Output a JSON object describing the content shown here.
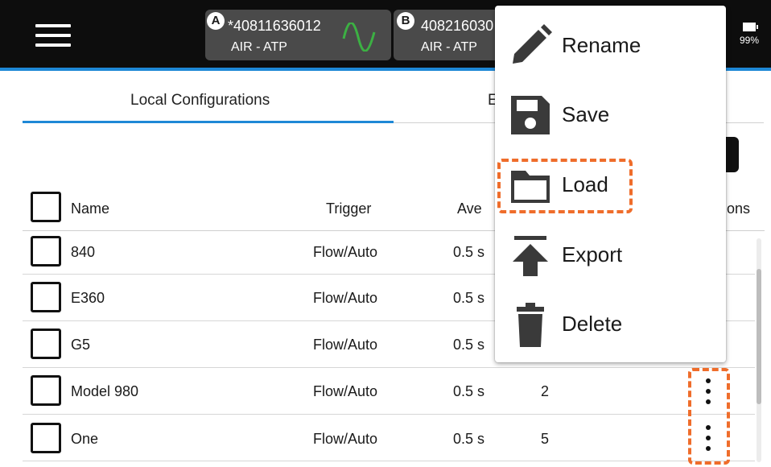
{
  "topbar": {
    "device_a": {
      "badge": "A",
      "serial": "*40811636012",
      "gas": "AIR - ATP",
      "wave_color": "#3cb043"
    },
    "device_b": {
      "badge": "B",
      "serial": "408216030",
      "gas": "AIR - ATP"
    },
    "battery": "99%"
  },
  "tabs": [
    {
      "label": "Local Configurations",
      "active": true
    },
    {
      "label": "E",
      "active": false
    }
  ],
  "table": {
    "headers": {
      "name": "Name",
      "trigger": "Trigger",
      "averaging": "Ave",
      "options": "ons"
    },
    "rows": [
      {
        "name": "840",
        "trigger": "Flow/Auto",
        "averaging": "0.5 s",
        "count": ""
      },
      {
        "name": "E360",
        "trigger": "Flow/Auto",
        "averaging": "0.5 s",
        "count": ""
      },
      {
        "name": "G5",
        "trigger": "Flow/Auto",
        "averaging": "0.5 s",
        "count": ""
      },
      {
        "name": "Model 980",
        "trigger": "Flow/Auto",
        "averaging": "0.5 s",
        "count": "2"
      },
      {
        "name": "One",
        "trigger": "Flow/Auto",
        "averaging": "0.5 s",
        "count": "5"
      }
    ]
  },
  "menu": {
    "items": [
      {
        "label": "Rename",
        "icon": "pencil-icon"
      },
      {
        "label": "Save",
        "icon": "floppy-disk-icon"
      },
      {
        "label": "Load",
        "icon": "folder-icon",
        "highlighted": true
      },
      {
        "label": "Export",
        "icon": "upload-icon"
      },
      {
        "label": "Delete",
        "icon": "trash-icon"
      }
    ]
  },
  "colors": {
    "accent": "#1e88d6",
    "highlight": "#ef6d2b",
    "topbar": "#0d0d0d",
    "device_card": "#4a4a4a"
  }
}
